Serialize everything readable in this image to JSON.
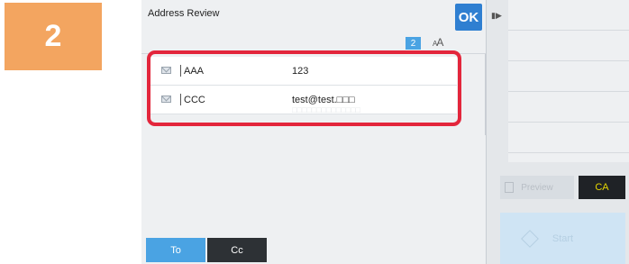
{
  "step": {
    "number": "2"
  },
  "dialog": {
    "title": "Address Review",
    "ok_label": "OK",
    "count": "2",
    "font_size_icon": "font-size-icon"
  },
  "addresses": [
    {
      "name": "AAA",
      "address": "123",
      "subtext": ""
    },
    {
      "name": "CCC",
      "address": "test@test.□□□",
      "subtext": "□□□□□□□□□□□□□□"
    }
  ],
  "tabs": [
    {
      "label": "To",
      "selected": true
    },
    {
      "label": "Cc",
      "selected": false
    }
  ],
  "side_panel": {
    "preview_label": "Preview",
    "ca_label": "CA",
    "start_label": "Start"
  },
  "colors": {
    "step_badge": "#f3a560",
    "ok_button": "#2f7fd1",
    "highlight_border": "#e3263c",
    "tab_selected": "#4aa3e3",
    "tab_unselected": "#2d3135",
    "ca_text": "#e6d700"
  }
}
